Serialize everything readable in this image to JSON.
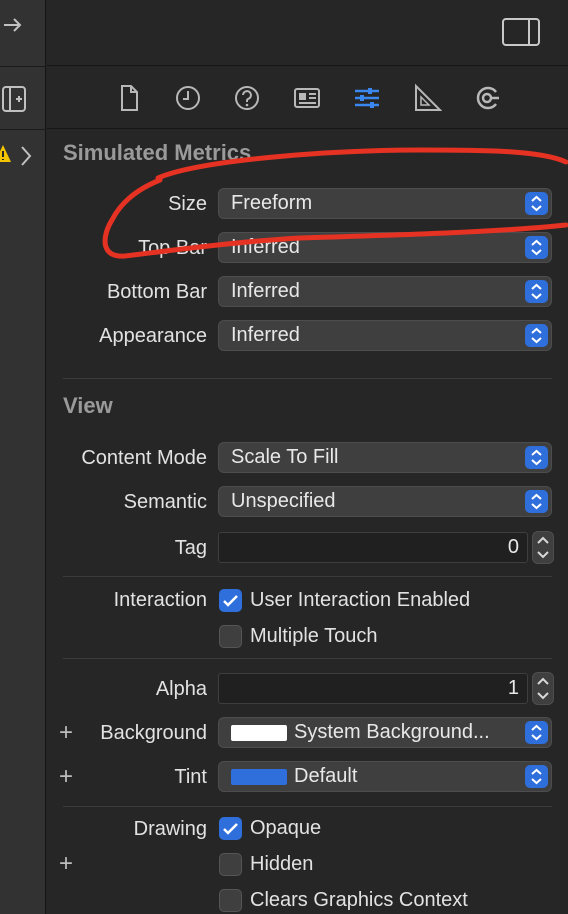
{
  "colors": {
    "accent": "#2f6fdc",
    "annotation": "#e53223",
    "background_swatch": "#ffffff",
    "tint_swatch": "#2f6fdc"
  },
  "left_strip": {
    "icons": [
      "arrow-right-icon",
      "add-square-icon",
      "warning-icon",
      "chevron-right-icon"
    ]
  },
  "tabs": [
    {
      "icon": "file-icon"
    },
    {
      "icon": "clock-icon"
    },
    {
      "icon": "help-icon"
    },
    {
      "icon": "identity-card-icon"
    },
    {
      "icon": "attributes-sliders-icon",
      "active": true
    },
    {
      "icon": "size-ruler-icon"
    },
    {
      "icon": "connections-icon"
    }
  ],
  "simulated_metrics": {
    "title": "Simulated Metrics",
    "size": {
      "label": "Size",
      "value": "Freeform"
    },
    "top_bar": {
      "label": "Top Bar",
      "value": "Inferred"
    },
    "bottom_bar": {
      "label": "Bottom Bar",
      "value": "Inferred"
    },
    "appearance": {
      "label": "Appearance",
      "value": "Inferred"
    }
  },
  "view": {
    "title": "View",
    "content_mode": {
      "label": "Content Mode",
      "value": "Scale To Fill"
    },
    "semantic": {
      "label": "Semantic",
      "value": "Unspecified"
    },
    "tag": {
      "label": "Tag",
      "value": "0"
    },
    "interaction": {
      "label": "Interaction",
      "user_interaction": {
        "label": "User Interaction Enabled",
        "checked": true
      },
      "multiple_touch": {
        "label": "Multiple Touch",
        "checked": false
      }
    },
    "alpha": {
      "label": "Alpha",
      "value": "1"
    },
    "background": {
      "label": "Background",
      "value": "System Background..."
    },
    "tint": {
      "label": "Tint",
      "value": "Default"
    },
    "drawing": {
      "label": "Drawing",
      "opaque": {
        "label": "Opaque",
        "checked": true
      },
      "hidden": {
        "label": "Hidden",
        "checked": false
      },
      "clears_graphics": {
        "label": "Clears Graphics Context",
        "checked": false
      }
    },
    "plus_symbol": "+"
  }
}
